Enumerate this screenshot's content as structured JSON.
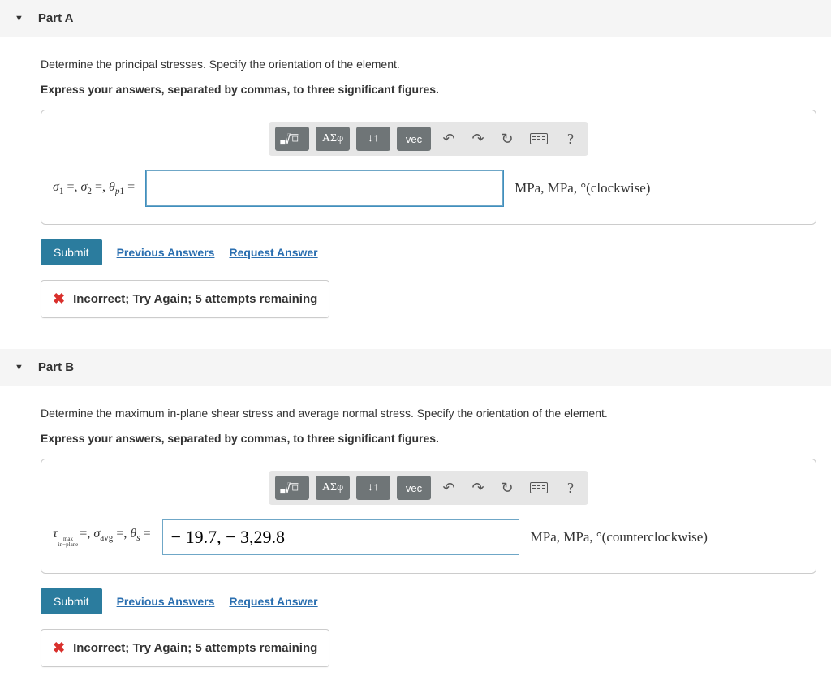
{
  "toolbar": {
    "template_label": "template",
    "greek_label": "ΑΣφ",
    "subsuper_label": "↓↑",
    "vec_label": "vec",
    "undo_label": "↶",
    "redo_label": "↷",
    "reset_label": "↻",
    "keyboard_label": "keyboard",
    "help_label": "?"
  },
  "actions": {
    "submit_label": "Submit",
    "previous_answers_label": "Previous Answers",
    "request_answer_label": "Request Answer"
  },
  "partA": {
    "title": "Part A",
    "prompt1": "Determine the principal stresses. Specify the orientation of the element.",
    "prompt2": "Express your answers, separated by commas, to three significant figures.",
    "lhs_html": "σ<sub>1</sub> =, σ<sub>2</sub> =, θ<sub>p1</sub> =",
    "input_value": "",
    "units": "MPa, MPa, °(clockwise)",
    "feedback": "Incorrect; Try Again; 5 attempts remaining"
  },
  "partB": {
    "title": "Part B",
    "prompt1": "Determine the maximum in-plane shear stress and average normal stress. Specify the orientation of the element.",
    "prompt2": "Express your answers, separated by commas, to three significant figures.",
    "tau_top": "max",
    "tau_bottom": "in−plane",
    "lhs_tail": " =, σavg =, θs =",
    "input_value": "− 19.7, − 3,29.8",
    "units": "MPa, MPa, °(counterclockwise)",
    "feedback": "Incorrect; Try Again; 5 attempts remaining"
  }
}
